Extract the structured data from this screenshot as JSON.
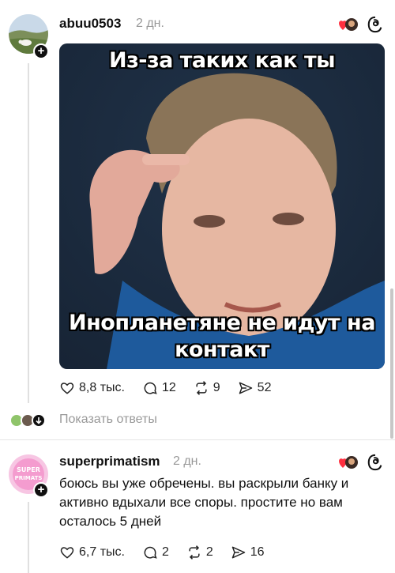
{
  "post": {
    "username": "abuu0503",
    "time": "2 дн.",
    "meme": {
      "top_text": "Из-за таких как ты",
      "bottom_text_line1": "Инопланетяне не идут на",
      "bottom_text_line2": "контакт"
    },
    "actions": {
      "likes": "8,8 тыс.",
      "comments": "12",
      "reposts": "9",
      "shares": "52"
    },
    "show_replies": "Показать ответы"
  },
  "reply": {
    "username": "superprimatism",
    "time": "2 дн.",
    "avatar_text": "SUPER PRIMATS",
    "text": "боюсь вы уже обречены. вы раскрыли банку и активно вдыхали все споры. простите но вам осталось 5 дней",
    "actions": {
      "likes": "6,7 тыс.",
      "comments": "2",
      "reposts": "2",
      "shares": "16"
    }
  },
  "colors": {
    "meme_bg": "#1b4f8a",
    "heart_red": "#ff3040",
    "muted": "#999999"
  }
}
